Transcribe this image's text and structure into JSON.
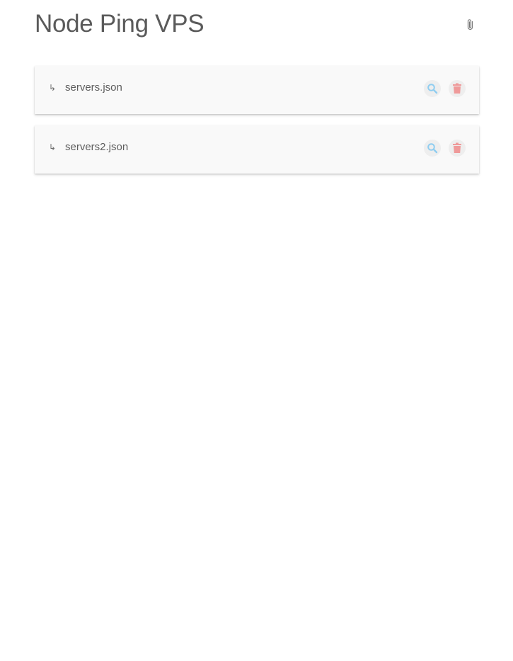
{
  "header": {
    "title": "Node Ping VPS",
    "attach_icon": "paperclip-icon"
  },
  "files": [
    {
      "arrow_glyph": "↳",
      "name": "servers.json",
      "view_icon": "search-icon",
      "delete_icon": "trash-icon"
    },
    {
      "arrow_glyph": "↳",
      "name": "servers2.json",
      "view_icon": "search-icon",
      "delete_icon": "trash-icon"
    }
  ],
  "colors": {
    "search_icon": "#8fcdf0",
    "delete_icon": "#ef9a9a",
    "paperclip_icon": "#777777",
    "card_background": "#f9f9f9"
  }
}
